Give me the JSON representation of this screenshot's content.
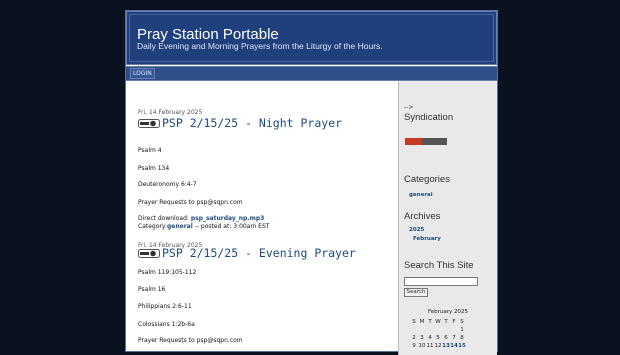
{
  "header": {
    "title": "Pray Station Portable",
    "description": "Daily Evening and Morning Prayers from the Liturgy of the Hours."
  },
  "nav": {
    "login": "LOGIN"
  },
  "posts": [
    {
      "date": "Fri, 14 February 2025",
      "title": "PSP 2/15/25 - Night Prayer",
      "lines": [
        "Psalm 4",
        "Psalm 134",
        "Deuteronomy 6:4-7",
        "Prayer Requests to psp@sqpn.com"
      ],
      "download_label": "Direct download:",
      "download_file": "psp_saturday_np.mp3",
      "category_label": "Category:",
      "category": "general",
      "posted": " -- posted at: 3:00am EST"
    },
    {
      "date": "Fri, 14 February 2025",
      "title": "PSP 2/15/25 - Evening Prayer",
      "lines": [
        "Psalm 119:105-112",
        "Psalm 16",
        "Philippians 2:6-11",
        "Colossians 1:2b-6a",
        "Prayer Requests to psp@sqpn.com"
      ]
    }
  ],
  "sidebar": {
    "syndication_arrow": "-->",
    "syndication": "Syndication",
    "categories": "Categories",
    "category_items": [
      "general"
    ],
    "archives": "Archives",
    "archive_year": "2025",
    "archive_month": "February",
    "search_title": "Search This Site",
    "search_button": "Search",
    "calendar_title": "February 2025",
    "calendar_days": [
      "S",
      "M",
      "T",
      "W",
      "T",
      "F",
      "S"
    ],
    "calendar_row1": [
      "",
      "",
      "",
      "",
      "",
      "",
      "1"
    ],
    "calendar_row2": [
      "2",
      "3",
      "4",
      "5",
      "6",
      "7",
      "8"
    ],
    "calendar_row3": [
      "9",
      "10",
      "11",
      "12",
      "13",
      "14",
      "15"
    ]
  }
}
